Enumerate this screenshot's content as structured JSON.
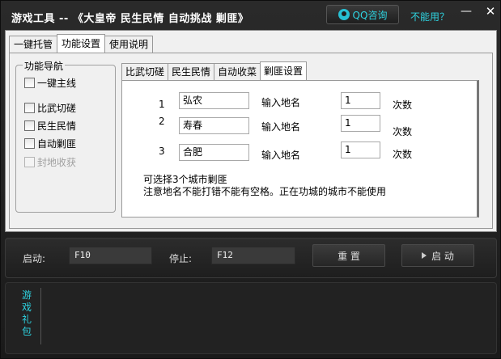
{
  "titlebar": {
    "title": "游戏工具 -- 《大皇帝 民生民情 自动挑战 剿匪》",
    "qq_label": "QQ咨询",
    "help_link": "不能用？",
    "minimize": "—",
    "close": "✕"
  },
  "top_tabs": [
    "一键托管",
    "功能设置",
    "使用说明"
  ],
  "nav": {
    "title": "功能导航",
    "items": [
      {
        "label": "一键主线",
        "checked": false,
        "disabled": false
      },
      {
        "label": "比武切磋",
        "checked": false,
        "disabled": false
      },
      {
        "label": "民生民情",
        "checked": false,
        "disabled": false
      },
      {
        "label": "自动剿匪",
        "checked": false,
        "disabled": false
      },
      {
        "label": "封地收获",
        "checked": false,
        "disabled": true
      }
    ]
  },
  "inner_tabs": [
    "比武切磋",
    "民生民情",
    "自动收菜",
    "剿匪设置"
  ],
  "bandit": {
    "rows": [
      {
        "num": "1",
        "city": "弘农",
        "city_label": "输入地名",
        "count": "1",
        "count_label": "次数"
      },
      {
        "num": "2",
        "city": "寿春",
        "city_label": "输入地名",
        "count": "1",
        "count_label": "次数"
      },
      {
        "num": "3",
        "city": "合肥",
        "city_label": "输入地名",
        "count": "1",
        "count_label": "次数"
      }
    ],
    "note1": "可选择3个城市剿匪",
    "note2": "注意地名不能打错不能有空格。正在功城的城市不能使用"
  },
  "hotkeys": {
    "start_label": "启动:",
    "start_key": "F10",
    "stop_label": "停止:",
    "stop_key": "F12",
    "reset_button": "重 置",
    "start_button": "启 动"
  },
  "bottom": {
    "gift_label": "游戏礼包"
  },
  "colors": {
    "accent": "#2ed3e0",
    "window_bg": "#1c1c1c",
    "panel_bg": "#f0f0f0"
  }
}
